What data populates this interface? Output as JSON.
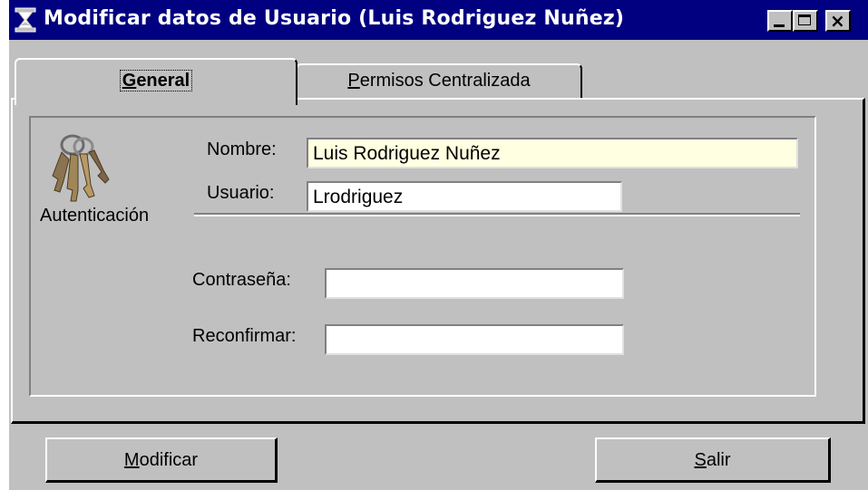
{
  "window": {
    "title": "Modificar datos de Usuario (Luis Rodriguez Nuñez)",
    "titlebar_color": "#000080",
    "face_color": "#c0c0c0"
  },
  "title_buttons": {
    "minimize": "minimize-icon",
    "maximize": "maximize-icon",
    "close": "close-icon"
  },
  "tabs": [
    {
      "label_first": "G",
      "label_rest": "eneral",
      "active": true
    },
    {
      "label_first": "P",
      "label_rest": "ermisos Centralizada",
      "active": false
    }
  ],
  "auth_section": {
    "icon": "keys-icon",
    "label": "Autenticación",
    "nombre_label": "Nombre:",
    "nombre_value": "Luis Rodriguez Nuñez",
    "nombre_bg": "#ffffe1",
    "usuario_label": "Usuario:",
    "usuario_value": "Lrodriguez",
    "password_label": "Contraseña:",
    "password_value": "",
    "reconfirm_label": "Reconfirmar:",
    "reconfirm_value": ""
  },
  "buttons": {
    "modificar_first": "M",
    "modificar_rest": "odificar",
    "salir_first": "S",
    "salir_rest": "alir"
  }
}
